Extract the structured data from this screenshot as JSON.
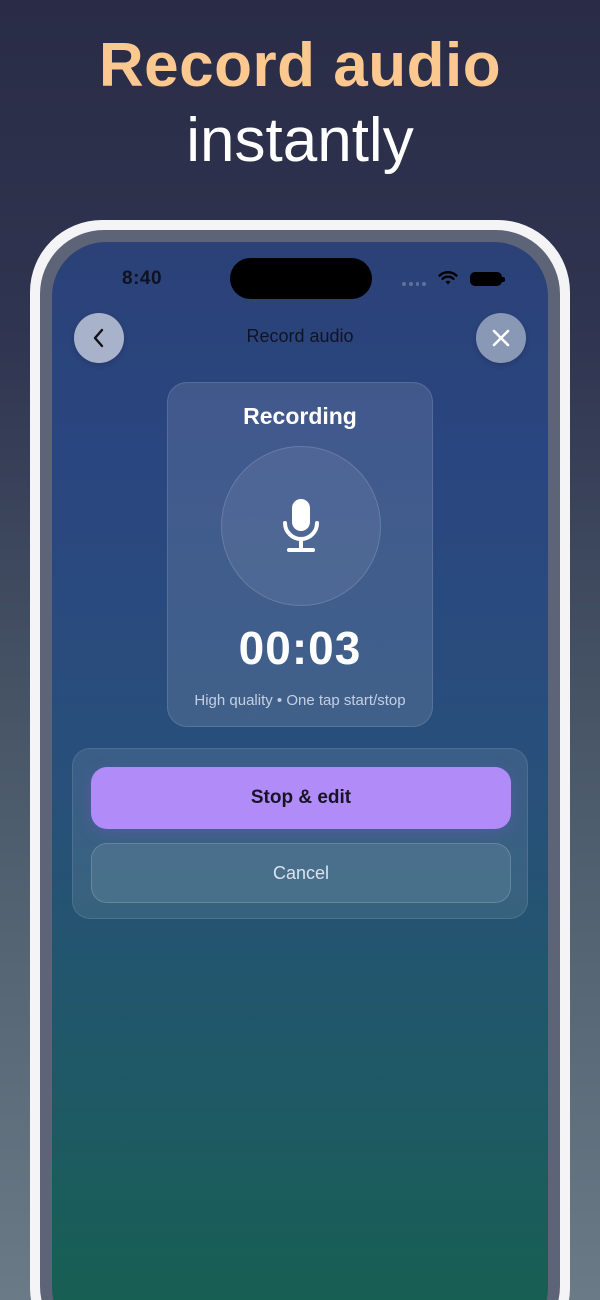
{
  "headline": {
    "line1": "Record audio",
    "line2": "instantly"
  },
  "status_bar": {
    "time": "8:40",
    "icons": [
      "wifi-icon",
      "battery-icon"
    ]
  },
  "nav": {
    "title": "Record audio",
    "back_icon": "chevron-left-icon",
    "close_icon": "close-icon"
  },
  "recording_card": {
    "title": "Recording",
    "icon": "microphone-icon",
    "timer": "00:03",
    "subtitle": "High quality • One tap start/stop"
  },
  "actions": {
    "primary_label": "Stop & edit",
    "secondary_label": "Cancel"
  },
  "colors": {
    "headline_accent": "#fbc88f",
    "primary_button": "#b18cf8"
  }
}
